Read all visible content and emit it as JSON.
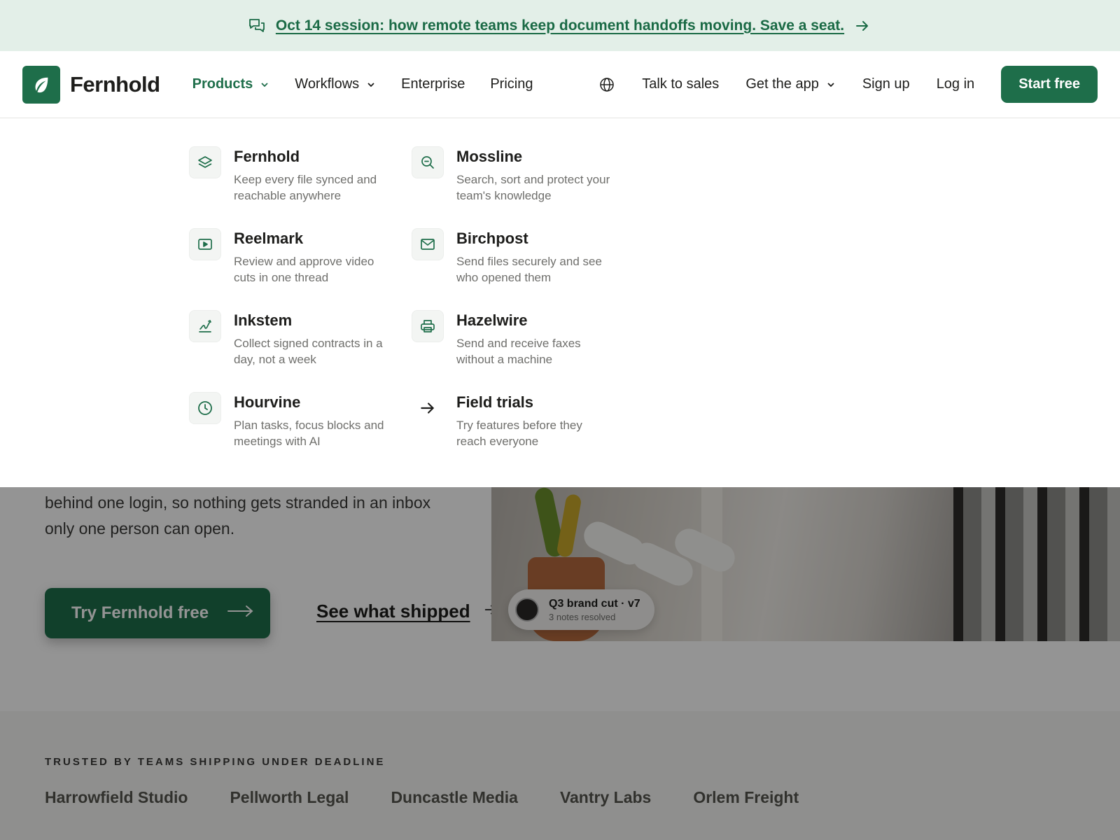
{
  "announcement": {
    "icon": "chat-bubbles-icon",
    "text": "Oct 14 session: how remote teams keep document handoffs moving. Save a seat.",
    "arrow_icon": "arrow-right-icon"
  },
  "nav": {
    "brand": "Fernhold",
    "logo_icon": "leaf-icon",
    "items": [
      {
        "label": "Products",
        "active": true,
        "dropdown": true
      },
      {
        "label": "Workflows",
        "dropdown": true
      },
      {
        "label": "Enterprise"
      },
      {
        "label": "Pricing"
      }
    ],
    "globe_icon": "globe-icon",
    "talk_to_sales": "Talk to sales",
    "get_app": "Get the app",
    "sign_up": "Sign up",
    "log_in": "Log in",
    "start_free": "Start free"
  },
  "mega_menu": {
    "items": [
      {
        "title": "Fernhold",
        "desc": "Keep every file synced and reachable anywhere",
        "icon": "layers-icon"
      },
      {
        "title": "Mossline",
        "desc": "Search, sort and protect your team's knowledge",
        "icon": "search-zoom-icon"
      },
      {
        "title": "Reelmark",
        "desc": "Review and approve video cuts in one thread",
        "icon": "video-play-icon"
      },
      {
        "title": "Birchpost",
        "desc": "Send files securely and see who opened them",
        "icon": "mail-icon"
      },
      {
        "title": "Inkstem",
        "desc": "Collect signed contracts in a day, not a week",
        "icon": "signature-icon"
      },
      {
        "title": "Hazelwire",
        "desc": "Send and receive faxes without a machine",
        "icon": "printer-icon"
      },
      {
        "title": "Hourvine",
        "desc": "Plan tasks, focus blocks and meetings with AI",
        "icon": "clock-icon"
      },
      {
        "title": "Field trials",
        "desc": "Try features before they reach everyone",
        "icon": "arrow-right-icon"
      }
    ]
  },
  "hero": {
    "text": "behind one login, so nothing gets stranded in an inbox only one person can open.",
    "cta_primary": "Try Fernhold free",
    "cta_secondary": "See what shipped",
    "note_title": "Q3 brand cut · v7",
    "note_sub": "3 notes resolved"
  },
  "trusted": {
    "label": "TRUSTED BY TEAMS SHIPPING UNDER DEADLINE",
    "logos": [
      "Harrowfield Studio",
      "Pellworth Legal",
      "Duncastle Media",
      "Vantry Labs",
      "Orlem Freight"
    ]
  },
  "colors": {
    "brand_green": "#1e6e4a",
    "announce_bg": "#e3efe8"
  }
}
